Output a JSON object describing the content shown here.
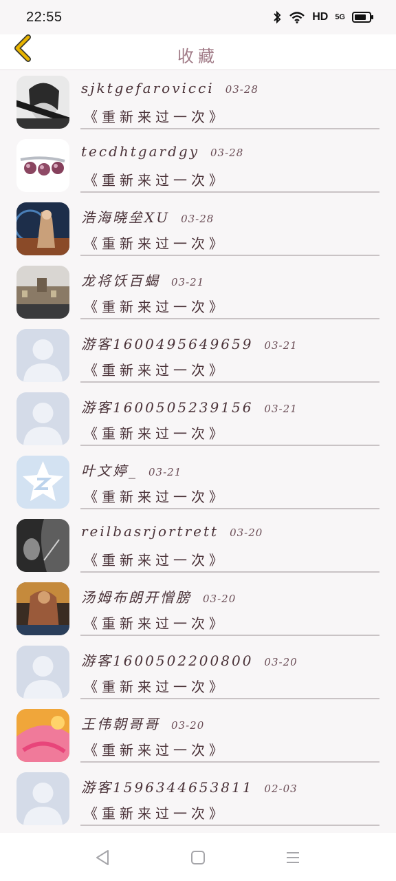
{
  "status": {
    "time": "22:55",
    "network": "HD",
    "signal": "5G"
  },
  "header": {
    "title": "收藏"
  },
  "items": [
    {
      "name": "sjktgefarovicci",
      "date": "03-28",
      "title": "《重新来过一次》",
      "avatar": "woman-portrait"
    },
    {
      "name": "tecdhtgardgy",
      "date": "03-28",
      "title": "《重新来过一次》",
      "avatar": "pearl-ring"
    },
    {
      "name": "浩海晓垒XU",
      "date": "03-28",
      "title": "《重新来过一次》",
      "avatar": "anime-figure"
    },
    {
      "name": "龙将饫百蝎",
      "date": "03-21",
      "title": "《重新来过一次》",
      "avatar": "city-street"
    },
    {
      "name": "游客1600495649659",
      "date": "03-21",
      "title": "《重新来过一次》",
      "avatar": "default-user"
    },
    {
      "name": "游客1600505239156",
      "date": "03-21",
      "title": "《重新来过一次》",
      "avatar": "default-user"
    },
    {
      "name": "叶文婷_",
      "date": "03-21",
      "title": "《重新来过一次》",
      "avatar": "qq-logo"
    },
    {
      "name": "reilbasrjortrett",
      "date": "03-20",
      "title": "《重新来过一次》",
      "avatar": "bw-portrait"
    },
    {
      "name": "汤姆布朗开憎膀",
      "date": "03-20",
      "title": "《重新来过一次》",
      "avatar": "game-hero"
    },
    {
      "name": "游客1600502200800",
      "date": "03-20",
      "title": "《重新来过一次》",
      "avatar": "default-user"
    },
    {
      "name": "王伟朝哥哥",
      "date": "03-20",
      "title": "《重新来过一次》",
      "avatar": "pink-flower"
    },
    {
      "name": "游客1596344653811",
      "date": "02-03",
      "title": "《重新来过一次》",
      "avatar": "default-user"
    }
  ],
  "colors": {
    "accent": "#e8b400",
    "title": "#a07a86",
    "divider": "#c9c3c5"
  }
}
